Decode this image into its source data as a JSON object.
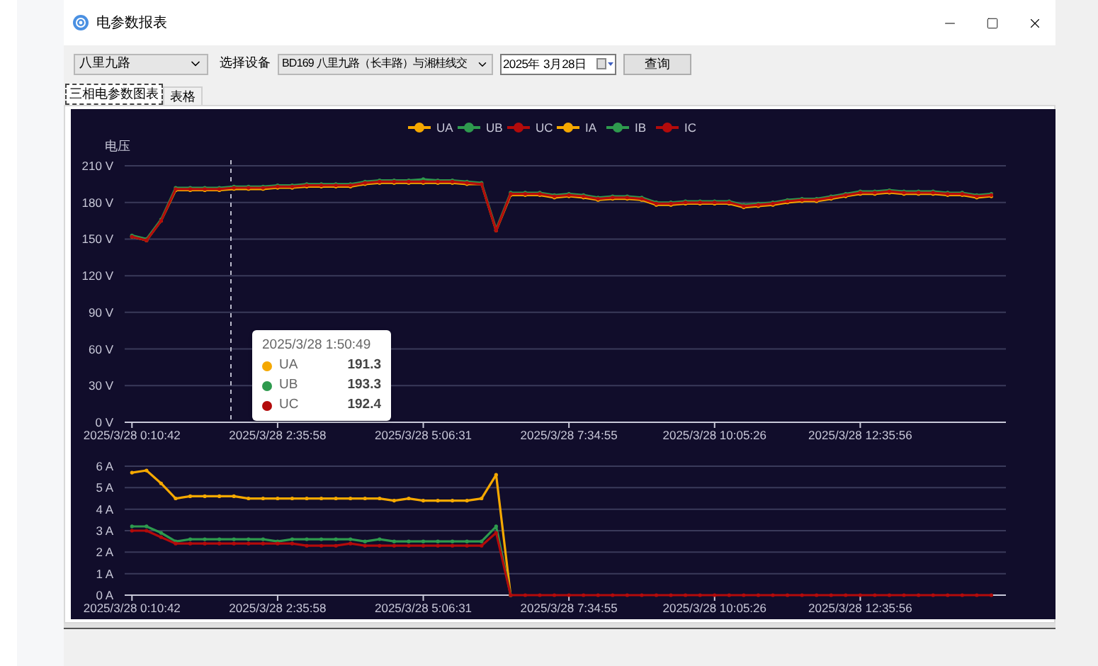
{
  "window": {
    "title": "电参数报表"
  },
  "toolbar": {
    "line_select": {
      "value": "八里九路"
    },
    "device_label": "选择设备",
    "device_select": {
      "value": "BD169 八里九路（长丰路）与湘桂线交"
    },
    "date_field": {
      "value": "2025年  3月28日"
    },
    "query_button": "查询"
  },
  "tabs": [
    {
      "label": "三相电参数图表",
      "selected": true
    },
    {
      "label": "表格",
      "selected": false
    }
  ],
  "voltage_chart": {
    "chart_data": {
      "type": "line",
      "ylabel": "电压",
      "grid": true,
      "legend": true,
      "categories": [
        "2025/3/28 0:10:42",
        null,
        null,
        null,
        null,
        null,
        null,
        null,
        null,
        null,
        "2025/3/28 2:35:58",
        null,
        null,
        null,
        null,
        null,
        null,
        null,
        null,
        null,
        "2025/3/28 5:06:31",
        null,
        null,
        null,
        null,
        null,
        null,
        null,
        null,
        null,
        "2025/3/28 7:34:55",
        null,
        null,
        null,
        null,
        null,
        null,
        null,
        null,
        null,
        "2025/3/28 10:05:26",
        null,
        null,
        null,
        null,
        null,
        null,
        null,
        null,
        null,
        "2025/3/28 12:35:56",
        null,
        null,
        null,
        null,
        null,
        null,
        null,
        null,
        null
      ],
      "ylim": [
        0,
        210
      ],
      "yticks": [
        {
          "value": 0,
          "label": "0 V"
        },
        {
          "value": 30,
          "label": "30 V"
        },
        {
          "value": 60,
          "label": "60 V"
        },
        {
          "value": 90,
          "label": "90 V"
        },
        {
          "value": 120,
          "label": "120 V"
        },
        {
          "value": 150,
          "label": "150 V"
        },
        {
          "value": 180,
          "label": "180 V"
        },
        {
          "value": 210,
          "label": "210 V"
        }
      ],
      "series": [
        {
          "name": "UA",
          "color": "#f5a800",
          "values": [
            152,
            149,
            165,
            190,
            190,
            190,
            190,
            191,
            191,
            191,
            192,
            192,
            193,
            193,
            193,
            193,
            195,
            196,
            196,
            196,
            196,
            196,
            196,
            195,
            195,
            157,
            186,
            186,
            186,
            184,
            185,
            184,
            182,
            183,
            183,
            182,
            178,
            178,
            179,
            179,
            179,
            179,
            176,
            177,
            178,
            180,
            181,
            181,
            183,
            185,
            187,
            187,
            188,
            187,
            187,
            187,
            186,
            186,
            184,
            185
          ]
        },
        {
          "name": "UB",
          "color": "#2e9a4e",
          "values": [
            153,
            150,
            166,
            192,
            192,
            192,
            192,
            193,
            193,
            193,
            194,
            194,
            195,
            195,
            195,
            195,
            197,
            198,
            198,
            198,
            199,
            198,
            198,
            197,
            196,
            158,
            188,
            188,
            188,
            186,
            187,
            186,
            184,
            185,
            185,
            184,
            180,
            180,
            181,
            181,
            181,
            181,
            178,
            179,
            180,
            182,
            183,
            183,
            185,
            187,
            189,
            189,
            190,
            189,
            189,
            189,
            188,
            188,
            186,
            187
          ]
        },
        {
          "name": "UC",
          "color": "#b30b0b",
          "values": [
            152,
            149,
            165,
            191,
            191,
            191,
            191,
            192,
            192,
            192,
            193,
            193,
            194,
            194,
            194,
            194,
            196,
            197,
            197,
            197,
            197,
            197,
            197,
            196,
            195,
            157,
            187,
            187,
            187,
            185,
            186,
            185,
            183,
            184,
            184,
            183,
            179,
            179,
            180,
            180,
            180,
            180,
            177,
            178,
            179,
            181,
            182,
            182,
            184,
            186,
            188,
            188,
            189,
            188,
            188,
            188,
            187,
            187,
            185,
            186
          ]
        }
      ]
    }
  },
  "current_chart": {
    "chart_data": {
      "type": "line",
      "grid": true,
      "legend": true,
      "categories": [
        "2025/3/28 0:10:42",
        null,
        null,
        null,
        null,
        null,
        null,
        null,
        null,
        null,
        "2025/3/28 2:35:58",
        null,
        null,
        null,
        null,
        null,
        null,
        null,
        null,
        null,
        "2025/3/28 5:06:31",
        null,
        null,
        null,
        null,
        null,
        null,
        null,
        null,
        null,
        "2025/3/28 7:34:55",
        null,
        null,
        null,
        null,
        null,
        null,
        null,
        null,
        null,
        "2025/3/28 10:05:26",
        null,
        null,
        null,
        null,
        null,
        null,
        null,
        null,
        null,
        "2025/3/28 12:35:56",
        null,
        null,
        null,
        null,
        null,
        null,
        null,
        null,
        null
      ],
      "ylim": [
        0,
        6
      ],
      "yticks": [
        {
          "value": 0,
          "label": "0 A"
        },
        {
          "value": 1,
          "label": "1 A"
        },
        {
          "value": 2,
          "label": "2 A"
        },
        {
          "value": 3,
          "label": "3 A"
        },
        {
          "value": 4,
          "label": "4 A"
        },
        {
          "value": 5,
          "label": "5 A"
        },
        {
          "value": 6,
          "label": "6 A"
        }
      ],
      "series": [
        {
          "name": "IA",
          "color": "#f5a800",
          "values": [
            5.7,
            5.8,
            5.2,
            4.5,
            4.6,
            4.6,
            4.6,
            4.6,
            4.5,
            4.5,
            4.5,
            4.5,
            4.5,
            4.5,
            4.5,
            4.5,
            4.5,
            4.5,
            4.4,
            4.5,
            4.4,
            4.4,
            4.4,
            4.4,
            4.5,
            5.6,
            0,
            null,
            null,
            null,
            null,
            null,
            null,
            null,
            null,
            null,
            null,
            null,
            null,
            null,
            null,
            null,
            null,
            null,
            null,
            null,
            null,
            null,
            null,
            null,
            null,
            null,
            null,
            null,
            null,
            null,
            null,
            null,
            null,
            null
          ]
        },
        {
          "name": "IB",
          "color": "#2e9a4e",
          "values": [
            3.2,
            3.2,
            2.9,
            2.5,
            2.6,
            2.6,
            2.6,
            2.6,
            2.6,
            2.6,
            2.5,
            2.6,
            2.6,
            2.6,
            2.6,
            2.6,
            2.5,
            2.6,
            2.5,
            2.5,
            2.5,
            2.5,
            2.5,
            2.5,
            2.5,
            3.2,
            0,
            null,
            null,
            null,
            null,
            null,
            null,
            null,
            null,
            null,
            null,
            null,
            null,
            null,
            null,
            null,
            null,
            null,
            null,
            null,
            null,
            null,
            null,
            null,
            null,
            null,
            null,
            null,
            null,
            null,
            null,
            null,
            null,
            null
          ]
        },
        {
          "name": "IC",
          "color": "#b30b0b",
          "values": [
            3.0,
            3.0,
            2.7,
            2.4,
            2.4,
            2.4,
            2.4,
            2.4,
            2.4,
            2.4,
            2.4,
            2.4,
            2.3,
            2.3,
            2.3,
            2.4,
            2.3,
            2.3,
            2.3,
            2.3,
            2.3,
            2.3,
            2.3,
            2.3,
            2.3,
            2.9,
            0,
            0,
            0,
            0,
            0,
            0,
            0,
            0,
            0,
            0,
            0,
            0,
            0,
            0,
            0,
            0,
            0,
            0,
            0,
            0,
            0,
            0,
            0,
            0,
            0,
            0,
            0,
            0,
            0,
            0,
            0,
            0,
            0,
            0
          ]
        }
      ]
    }
  },
  "tooltip": {
    "title": "2025/3/28 1:50:49",
    "rows": [
      {
        "name": "UA",
        "value": "191.3",
        "color": "#f5a800"
      },
      {
        "name": "UB",
        "value": "193.3",
        "color": "#2e9a4e"
      },
      {
        "name": "UC",
        "value": "192.4",
        "color": "#b30b0b"
      }
    ]
  }
}
